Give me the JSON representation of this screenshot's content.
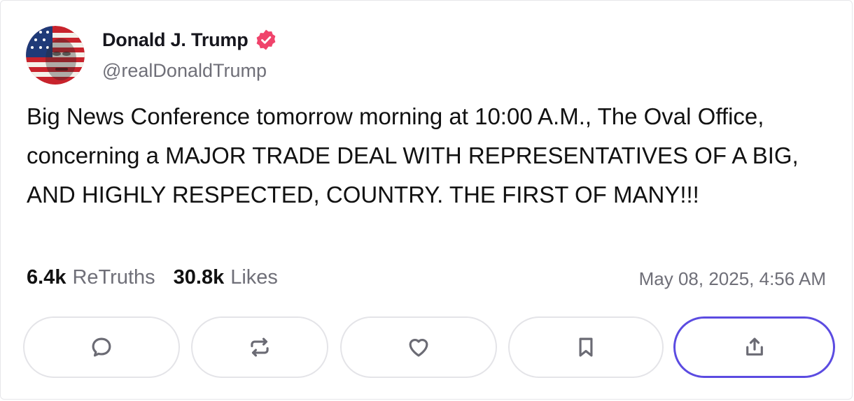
{
  "post": {
    "author_name": "Donald J. Trump",
    "verified_icon": "verified-badge-icon",
    "handle": "@realDonaldTrump",
    "text": "Big News Conference tomorrow morning at 10:00 A.M., The Oval Office, concerning a MAJOR TRADE DEAL WITH REPRESENTATIVES OF A BIG, AND HIGHLY RESPECTED, COUNTRY. THE FIRST OF MANY!!!",
    "retruths_count": "6.4k",
    "retruths_label": "ReTruths",
    "likes_count": "30.8k",
    "likes_label": "Likes",
    "timestamp": "May 08, 2025, 4:56 AM"
  },
  "actions": [
    {
      "name": "reply",
      "icon": "comment-icon"
    },
    {
      "name": "retruth",
      "icon": "repost-icon"
    },
    {
      "name": "like",
      "icon": "heart-icon"
    },
    {
      "name": "bookmark",
      "icon": "bookmark-icon"
    },
    {
      "name": "share",
      "icon": "share-icon",
      "focused": true
    }
  ],
  "colors": {
    "verified_badge": "#f0436b",
    "focus_ring": "#5b4be1",
    "secondary_text": "#6f6f78",
    "icon_gray": "#6b6b74"
  }
}
